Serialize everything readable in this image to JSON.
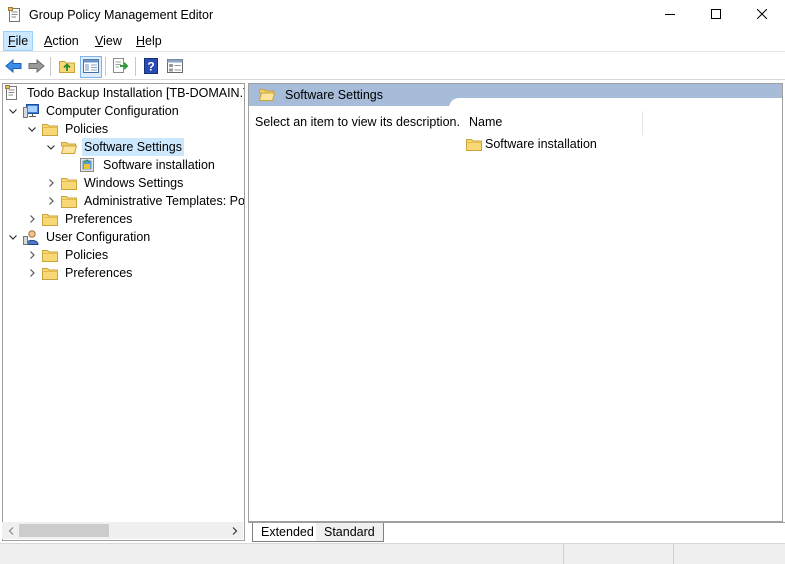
{
  "window": {
    "title": "Group Policy Management Editor",
    "icons": {
      "app": "policy-document-icon",
      "minimize": "minimize-icon",
      "maximize": "maximize-icon",
      "close": "close-icon"
    }
  },
  "menu": {
    "file": {
      "accel": "F",
      "rest": "ile"
    },
    "action": {
      "accel": "A",
      "rest": "ction"
    },
    "view": {
      "accel": "V",
      "rest": "iew"
    },
    "help": {
      "accel": "H",
      "rest": "elp"
    }
  },
  "toolbar": {
    "icons": [
      "back-arrow-icon",
      "forward-arrow-icon",
      "up-folder-icon",
      "show-hide-tree-icon",
      "export-list-icon",
      "help-icon",
      "properties-icon"
    ]
  },
  "tree": {
    "root": "Todo Backup Installation [TB-DOMAIN.TB",
    "computer_config": "Computer Configuration",
    "cc_policies": "Policies",
    "software_settings": "Software Settings",
    "software_installation": "Software installation",
    "windows_settings": "Windows Settings",
    "admin_templates": "Administrative Templates: Poli",
    "cc_preferences": "Preferences",
    "user_config": "User Configuration",
    "uc_policies": "Policies",
    "uc_preferences": "Preferences"
  },
  "right_pane": {
    "header_title": "Software Settings",
    "description": "Select an item to view its description.",
    "column_name": "Name",
    "items": [
      "Software installation"
    ]
  },
  "tabs": {
    "extended": "Extended",
    "standard": "Standard"
  },
  "colors": {
    "header_bg": "#a6bcd8",
    "selection": "#cce8ff",
    "folder": "#f5d66b"
  }
}
